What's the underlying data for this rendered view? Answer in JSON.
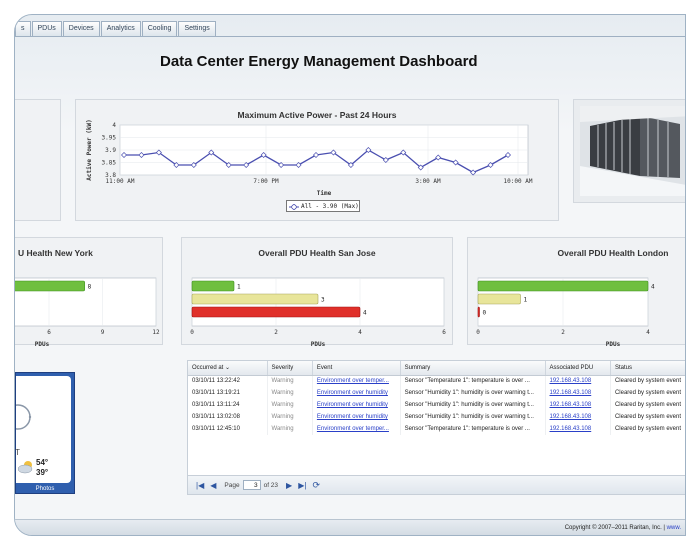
{
  "tabs": [
    "s",
    "PDUs",
    "Devices",
    "Analytics",
    "Cooling",
    "Settings"
  ],
  "page_title": "Data Center Energy Management Dashboard",
  "power_chart": {
    "title": "Maximum Active Power - Past 24 Hours",
    "y_label": "Active Power (kW)",
    "y_ticks": [
      "4",
      "3.95",
      "3.9",
      "3.85",
      "3.8"
    ],
    "x_ticks": [
      "11:00 AM",
      "7:00 PM",
      "3:00 AM",
      "10:00 AM"
    ],
    "x_label": "Time",
    "legend": "All - 3.90 (Max)",
    "color": "#4a4fb0"
  },
  "chart_data": [
    {
      "type": "line",
      "title": "Maximum Active Power - Past 24 Hours",
      "xlabel": "Time",
      "ylabel": "Active Power (kW)",
      "ylim": [
        3.8,
        4.0
      ],
      "series": [
        {
          "name": "All - 3.90 (Max)",
          "values": [
            3.88,
            3.88,
            3.89,
            3.84,
            3.84,
            3.89,
            3.84,
            3.84,
            3.88,
            3.84,
            3.84,
            3.88,
            3.89,
            3.84,
            3.9,
            3.86,
            3.89,
            3.83,
            3.87,
            3.85,
            3.81,
            3.84,
            3.88
          ]
        }
      ]
    },
    {
      "type": "bar",
      "title": "Overall PDU Health New York",
      "xlabel": "PDUs",
      "xlim": [
        0,
        12
      ],
      "x_ticks": [
        "6",
        "9",
        "12"
      ],
      "values": [
        8
      ]
    },
    {
      "type": "bar",
      "title": "Overall PDU Health San Jose",
      "xlabel": "PDUs",
      "xlim": [
        0,
        6
      ],
      "x_ticks": [
        "0",
        "2",
        "4",
        "6"
      ],
      "values": [
        1,
        3,
        4
      ],
      "colors": [
        "#6fbf3f",
        "#e8e59a",
        "#e0302a"
      ]
    },
    {
      "type": "bar",
      "title": "Overall PDU Health London",
      "xlabel": "PDUs",
      "xlim": [
        0,
        4
      ],
      "x_ticks": [
        "0",
        "2",
        "4"
      ],
      "values": [
        4,
        1,
        0
      ],
      "colors": [
        "#6fbf3f",
        "#e8e59a",
        "#e0302a"
      ]
    }
  ],
  "health_ny": {
    "title": "U Health New York",
    "value_label": "8",
    "ticks": [
      "6",
      "9",
      "12"
    ],
    "xlabel": "PDUs"
  },
  "health_sj": {
    "title": "Overall PDU Health San Jose",
    "labels": [
      "1",
      "3",
      "4"
    ],
    "ticks": [
      "0",
      "2",
      "4",
      "6"
    ],
    "xlabel": "PDUs"
  },
  "health_lon": {
    "title": "Overall PDU Health London",
    "labels": [
      "4",
      "1",
      "0"
    ],
    "ticks": [
      "0",
      "2",
      "4"
    ],
    "xlabel": "PDUs"
  },
  "weather": {
    "temp_high": "54°",
    "temp_low": "39°",
    "letter": "T",
    "photos": "Photos"
  },
  "events": {
    "columns": [
      "Occurred at",
      "Severity",
      "Event",
      "Summary",
      "Associated PDU",
      "Status"
    ],
    "rows": [
      {
        "time": "03/10/11 13:22:42",
        "severity": "Warning",
        "event": "Environment over temper...",
        "summary": "Sensor \"Temperature 1\": temperature is over ...",
        "pdu": "192.168.43.108",
        "status": "Cleared by system event"
      },
      {
        "time": "03/10/11 13:19:21",
        "severity": "Warning",
        "event": "Environment over humidity",
        "summary": "Sensor \"Humidity 1\": humidity is over warning t...",
        "pdu": "192.168.43.108",
        "status": "Cleared by system event"
      },
      {
        "time": "03/10/11 13:11:24",
        "severity": "Warning",
        "event": "Environment over humidity",
        "summary": "Sensor \"Humidity 1\": humidity is over warning t...",
        "pdu": "192.168.43.108",
        "status": "Cleared by system event"
      },
      {
        "time": "03/10/11 13:02:08",
        "severity": "Warning",
        "event": "Environment over humidity",
        "summary": "Sensor \"Humidity 1\": humidity is over warning t...",
        "pdu": "192.168.43.108",
        "status": "Cleared by system event"
      },
      {
        "time": "03/10/11 12:45:10",
        "severity": "Warning",
        "event": "Environment over temper...",
        "summary": "Sensor \"Temperature 1\": temperature is over ...",
        "pdu": "192.168.43.108",
        "status": "Cleared by system event"
      }
    ]
  },
  "pager": {
    "page_label": "Page",
    "current": "3",
    "of_label": "of 23"
  },
  "footer": {
    "copyright": "Copyright © 2007–2011 Raritan, Inc. |",
    "link": "www."
  }
}
